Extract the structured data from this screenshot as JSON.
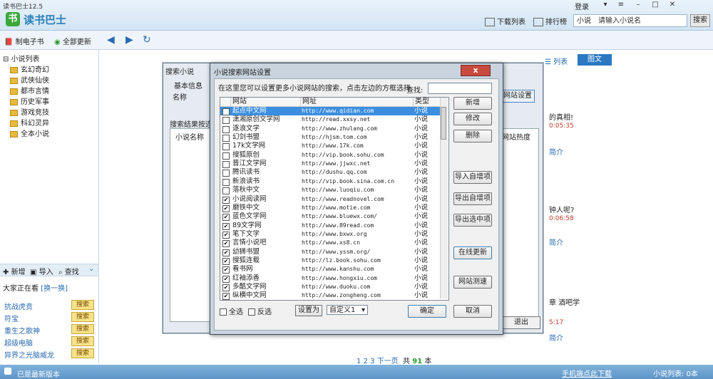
{
  "app": {
    "version_title": "读书巴士12.5",
    "name": "读书巴士"
  },
  "topbar": {
    "login": "登录",
    "download_list": "下载列表",
    "ranking": "排行榜",
    "search_scope": "小说",
    "search_placeholder": "请输入小说名",
    "search_button": "搜索"
  },
  "toolbar": {
    "make_ebook": "制电子书",
    "update_all": "全部更新"
  },
  "tree": {
    "root": "小说列表",
    "items": [
      "玄幻奇幻",
      "武侠仙侠",
      "都市言情",
      "历史军事",
      "游戏竞技",
      "科幻灵异",
      "全本小说"
    ]
  },
  "left_actions": {
    "add": "新增",
    "import": "导入",
    "find": "查找"
  },
  "reading": {
    "title": "大家正在看",
    "swap": "[换一换]",
    "items": [
      "抗战虎贲",
      "符宝",
      "重生之歌神",
      "超级电脑",
      "异界之光脑威龙"
    ],
    "btn": "搜索"
  },
  "right": {
    "tab_list": "列表",
    "tab_pic": "图文",
    "text1": "的真相!",
    "time1": "0:05:35",
    "link1": "简介",
    "text2": "钟人呢?",
    "time2": "0:06:58",
    "link2": "简介",
    "text3": "章 酒吧学",
    "time3": "5:17",
    "link3": "简介"
  },
  "pager": {
    "p1": "1",
    "p2": "2",
    "p3": "3",
    "next": "下一页",
    "total_pre": "共",
    "total": "91",
    "total_post": "本"
  },
  "status": {
    "left": "已是最新版本",
    "mid": "手机端点此下载",
    "right": "小说列表: 0本"
  },
  "bg_dialog": {
    "title": "搜索小说",
    "basic": "基本信息",
    "name": "名称",
    "results": "搜索结果按连接",
    "col_name": "小说名称",
    "site_settings": "网站设置",
    "heat": "网站热度",
    "exit": "退出"
  },
  "dialog": {
    "title": "小说搜索网站设置",
    "close": "x",
    "hint": "在这里您可以设置更多小说网站的搜索，点击左边的方框选择",
    "find": "查找:",
    "headers": {
      "site": "网站",
      "url": "网址",
      "type": "类型"
    },
    "rows": [
      {
        "site": "起点中文网",
        "url": "http://www.qidian.com",
        "type": "小说",
        "checked": false,
        "selected": true
      },
      {
        "site": "潇湘原创文学网",
        "url": "http://read.xxsy.net",
        "type": "小说",
        "checked": false
      },
      {
        "site": "逐浪文学",
        "url": "http://www.zhulang.com",
        "type": "小说",
        "checked": false
      },
      {
        "site": "幻剑书盟",
        "url": "http://hjsm.tom.com",
        "type": "小说",
        "checked": false
      },
      {
        "site": "17k文学网",
        "url": "http://www.17k.com",
        "type": "小说",
        "checked": false
      },
      {
        "site": "搜狐原创",
        "url": "http://vip.book.sohu.com",
        "type": "小说",
        "checked": false
      },
      {
        "site": "晋江文学网",
        "url": "http://www.jjwxc.net",
        "type": "小说",
        "checked": false
      },
      {
        "site": "腾讯读书",
        "url": "http://dushu.qq.com",
        "type": "小说",
        "checked": false
      },
      {
        "site": "新浪读书",
        "url": "http://vip.book.sina.com.cn",
        "type": "小说",
        "checked": false
      },
      {
        "site": "落秋中文",
        "url": "http://www.luoqiu.com",
        "type": "小说",
        "checked": false
      },
      {
        "site": "小说阅读网",
        "url": "http://www.readnovel.com",
        "type": "小说",
        "checked": true
      },
      {
        "site": "磨铁中文",
        "url": "http://www.motie.com",
        "type": "小说",
        "checked": true
      },
      {
        "site": "蓝色文学网",
        "url": "http://www.bluewx.com/",
        "type": "小说",
        "checked": true
      },
      {
        "site": "89文学网",
        "url": "http://www.89read.com",
        "type": "小说",
        "checked": true
      },
      {
        "site": "笔下文学",
        "url": "http://www.bxwx.org",
        "type": "小说",
        "checked": true
      },
      {
        "site": "言情小说吧",
        "url": "http://www.xs8.cn",
        "type": "小说",
        "checked": true
      },
      {
        "site": "幼狮书盟",
        "url": "http://www.yssm.org/",
        "type": "小说",
        "checked": true
      },
      {
        "site": "搜狐连载",
        "url": "http://lz.book.sohu.com",
        "type": "小说",
        "checked": true
      },
      {
        "site": "看书网",
        "url": "http://www.kanshu.com",
        "type": "小说",
        "checked": true
      },
      {
        "site": "红袖添香",
        "url": "http://www.hongxiu.com",
        "type": "小说",
        "checked": true
      },
      {
        "site": "多酷文学网",
        "url": "http://www.duoku.com",
        "type": "小说",
        "checked": true
      },
      {
        "site": "纵横中文网",
        "url": "http://www.zongheng.com",
        "type": "小说",
        "checked": true
      }
    ],
    "buttons": {
      "add": "新增",
      "edit": "修改",
      "delete": "删除",
      "import_custom": "导入自增项",
      "export_custom": "导出自增项",
      "export_selected": "导出选中项",
      "online_update": "在线更新",
      "speed_test": "网站测速"
    },
    "select_all": "全选",
    "invert": "反选",
    "set_as": "设置为",
    "custom": "自定义1",
    "ok": "确定",
    "cancel": "取消"
  }
}
